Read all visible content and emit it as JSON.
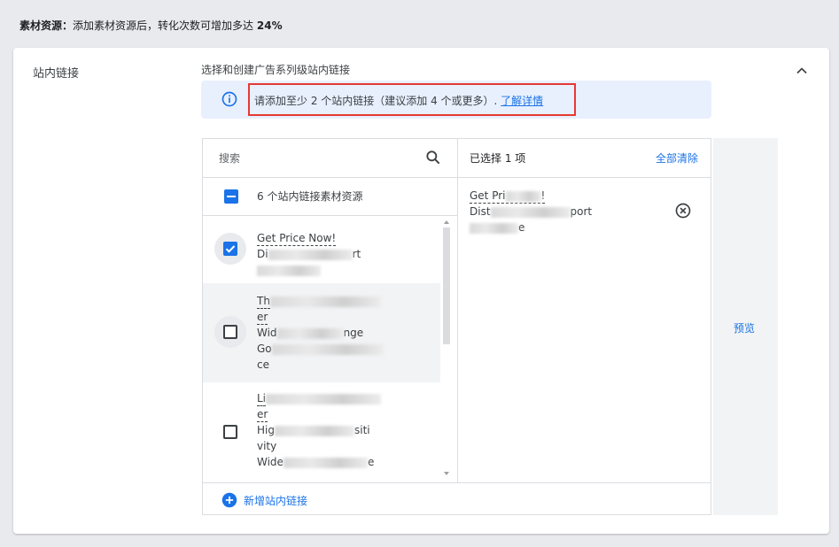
{
  "header": {
    "label": "素材资源",
    "separator": "：",
    "text": "添加素材资源后，转化次数可增加多达",
    "percent": "24%"
  },
  "section": {
    "label": "站内链接",
    "subtitle": "选择和创建广告系列级站内链接"
  },
  "info": {
    "message": "请添加至少 2 个站内链接（建议添加 4 个或更多）. ",
    "link": "了解详情"
  },
  "search": {
    "placeholder": "搜索"
  },
  "list": {
    "all_label": "6 个站内链接素材资源",
    "items": [
      {
        "line1": "Get Price Now!",
        "line2": "Di",
        "line2b": "rt",
        "line3": "",
        "checked": true
      },
      {
        "line1": "Th",
        "line2": "er",
        "line3": "Wid",
        "line3b": "nge",
        "line4": "Go",
        "line5": "ce",
        "checked": false
      },
      {
        "line1": "Li",
        "line2": "er",
        "line3": "Hig",
        "line3b": "siti",
        "line4": "vity",
        "line5": "Wide",
        "line5b": "e",
        "checked": false
      }
    ]
  },
  "selected": {
    "count_label": "已选择 1 项",
    "clear_label": "全部清除",
    "item": {
      "line1": "Get Pri",
      "line1b": "!",
      "line2": "Dist",
      "line2b": "port",
      "line3": "",
      "line3b": "e"
    }
  },
  "footer": {
    "add_label": "新增站内链接"
  },
  "preview": {
    "label": "预览"
  },
  "colors": {
    "accent": "#1a73e8",
    "highlight": "#e53935",
    "info_bg": "#e8f0fe"
  }
}
